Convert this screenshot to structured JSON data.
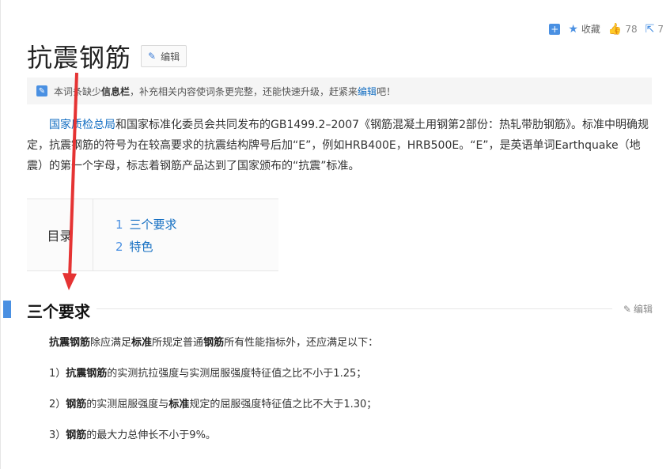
{
  "top_actions": {
    "add_icon": "plus-square-icon",
    "favorite_label": "收藏",
    "like_count": "78",
    "share_count": "7"
  },
  "title": {
    "text": "抗震钢筋",
    "edit_label": "编辑"
  },
  "notice": {
    "p1": "本词条缺少",
    "bold": "信息栏",
    "p2": "，补充相关内容使词条更完整，还能快速升级，赶紧来",
    "link": "编辑",
    "p3": "吧！"
  },
  "lead": {
    "link": "国家质检总局",
    "text": "和国家标准化委员会共同发布的GB1499.2–2007《钢筋混凝土用钢第2部份：热轧带肋钢筋》。标准中明确规定，抗震钢筋的符号为在较高要求的抗震结构牌号后加“E”，例如HRB400E，HRB500E。“E”，是英语单词Earthquake（地震）的第一个字母，标志着钢筋产品达到了国家颁布的“抗震”标准。"
  },
  "toc": {
    "label": "目录",
    "items": [
      {
        "num": "1",
        "label": "三个要求"
      },
      {
        "num": "2",
        "label": "特色"
      }
    ]
  },
  "section": {
    "title": "三个要求",
    "edit_label": "编辑"
  },
  "paragraphs": {
    "intro_b1": "抗震钢筋",
    "intro_t1": "除应满足",
    "intro_b2": "标准",
    "intro_t2": "所规定普通",
    "intro_b3": "钢筋",
    "intro_t3": "所有性能指标外，还应满足以下：",
    "r1_pre": "1）",
    "r1_b": "抗震钢筋",
    "r1_t": "的实测抗拉强度与实测屈服强度特征值之比不小于1.25；",
    "r2_pre": "2）",
    "r2_b1": "钢筋",
    "r2_t1": "的实测屈服强度与",
    "r2_b2": "标准",
    "r2_t2": "规定的屈服强度特征值之比不大于1.30；",
    "r3_pre": "3）",
    "r3_b": "钢筋",
    "r3_t": "的最大力总伸长不小于9%。"
  },
  "colors": {
    "accent": "#4a90e2",
    "link": "#136ec2",
    "arrow": "#e53333"
  }
}
